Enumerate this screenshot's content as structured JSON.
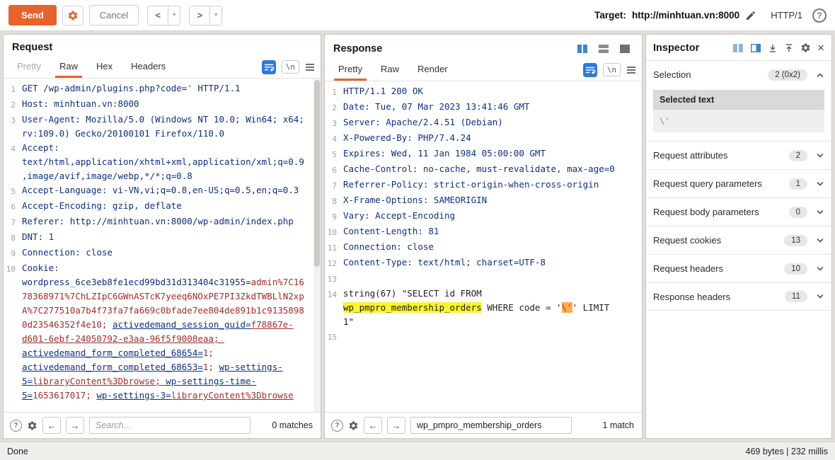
{
  "icons": {
    "dropdown": "▼",
    "help": "?",
    "close": "×",
    "back_arrow": "←",
    "forward_arrow": "→",
    "prev": "<",
    "next": ">"
  },
  "topbar": {
    "send_label": "Send",
    "cancel_label": "Cancel",
    "target_label": "Target:",
    "target_value": "http://minhtuan.vn:8000",
    "http_version": "HTTP/1"
  },
  "request": {
    "title": "Request",
    "tabs": [
      "Pretty",
      "Raw",
      "Hex",
      "Headers"
    ],
    "active_tab": "Raw",
    "muted_tab": "Pretty",
    "newline_glyph": "\\n",
    "search": {
      "placeholder": "Search...",
      "value": "",
      "matches": "0 matches"
    },
    "lines": [
      {
        "n": 1,
        "segs": [
          {
            "t": "GET /wp-admin/plugins.php",
            "c": "h"
          },
          {
            "t": "?code=",
            "c": "h"
          },
          {
            "t": "'",
            "c": "v"
          },
          {
            "t": " HTTP/1.1",
            "c": "h"
          }
        ]
      },
      {
        "n": 2,
        "segs": [
          {
            "t": "Host: minhtuan.vn:8000",
            "c": "h"
          }
        ]
      },
      {
        "n": 3,
        "segs": [
          {
            "t": "User-Agent: Mozilla/5.0 (Windows NT 10.0; Win64; x64; rv:109.0) Gecko/20100101 Firefox/110.0",
            "c": "h"
          }
        ]
      },
      {
        "n": 4,
        "segs": [
          {
            "t": "Accept: text/html,application/xhtml+xml,application/xml;q=0.9,image/avif,image/webp,*/*;q=0.8",
            "c": "h"
          }
        ]
      },
      {
        "n": 5,
        "segs": [
          {
            "t": "Accept-Language: vi-VN,vi;q=0.8,en-US;q=0.5,en;q=0.3",
            "c": "h"
          }
        ]
      },
      {
        "n": 6,
        "segs": [
          {
            "t": "Accept-Encoding: gzip, deflate",
            "c": "h"
          }
        ]
      },
      {
        "n": 7,
        "segs": [
          {
            "t": "Referer: http://minhtuan.vn:8000/wp-admin/index.php",
            "c": "h"
          }
        ]
      },
      {
        "n": 8,
        "segs": [
          {
            "t": "DNT: 1",
            "c": "h"
          }
        ]
      },
      {
        "n": 9,
        "segs": [
          {
            "t": "Connection: close",
            "c": "h"
          }
        ]
      },
      {
        "n": 10,
        "segs": [
          {
            "t": "Cookie: ",
            "c": "h"
          },
          {
            "t": "wordpress_6ce3eb8fe1ecd99bd31d313404c31955=",
            "c": "h"
          },
          {
            "t": "admin%7C1678368971%7ChLZIpC6GWnASTcK7yeeq6NOxPE7PI3ZkdTWBLlN2xpA%7C277510a7b4f73fa7fa669c0bfade7ee804de891b1c91358980d23546352f4e10; ",
            "c": "v"
          },
          {
            "t": "activedemand_session_guid=",
            "c": "u"
          },
          {
            "t": "f78867e-d601-6ebf-24050792-e3aa-96f5f9008eaa; ",
            "c": "vu"
          },
          {
            "t": "activedemand_form_completed_68654=",
            "c": "u"
          },
          {
            "t": "1; ",
            "c": "v"
          },
          {
            "t": "activedemand_form_completed_68653=",
            "c": "u"
          },
          {
            "t": "1; ",
            "c": "v"
          },
          {
            "t": "wp-settings-5=",
            "c": "u"
          },
          {
            "t": "libraryContent%3Dbrowse; ",
            "c": "vu"
          },
          {
            "t": "wp-settings-time-5=",
            "c": "u"
          },
          {
            "t": "1653617017; ",
            "c": "v"
          },
          {
            "t": "wp-settings-3=",
            "c": "u"
          },
          {
            "t": "libraryContent%3Dbrowse",
            "c": "vu"
          }
        ]
      }
    ]
  },
  "response": {
    "title": "Response",
    "tabs": [
      "Pretty",
      "Raw",
      "Render"
    ],
    "active_tab": "Pretty",
    "muted_tab": "",
    "newline_glyph": "\\n",
    "search": {
      "placeholder": "Search...",
      "value": "wp_pmpro_membership_orders",
      "matches": "1 match"
    },
    "lines": [
      {
        "n": 1,
        "segs": [
          {
            "t": "HTTP/1.1 200 OK",
            "c": "h"
          }
        ]
      },
      {
        "n": 2,
        "segs": [
          {
            "t": "Date: Tue, 07 Mar 2023 13:41:46 GMT",
            "c": "h"
          }
        ]
      },
      {
        "n": 3,
        "segs": [
          {
            "t": "Server: Apache/2.4.51 (Debian)",
            "c": "h"
          }
        ]
      },
      {
        "n": 4,
        "segs": [
          {
            "t": "X-Powered-By: PHP/7.4.24",
            "c": "h"
          }
        ]
      },
      {
        "n": 5,
        "segs": [
          {
            "t": "Expires: Wed, 11 Jan 1984 05:00:00 GMT",
            "c": "h"
          }
        ]
      },
      {
        "n": 6,
        "segs": [
          {
            "t": "Cache-Control: no-cache, must-revalidate, max-age=0",
            "c": "h"
          }
        ]
      },
      {
        "n": 7,
        "segs": [
          {
            "t": "Referrer-Policy: strict-origin-when-cross-origin",
            "c": "h"
          }
        ]
      },
      {
        "n": 8,
        "segs": [
          {
            "t": "X-Frame-Options: SAMEORIGIN",
            "c": "h"
          }
        ]
      },
      {
        "n": 9,
        "segs": [
          {
            "t": "Vary: Accept-Encoding",
            "c": "h"
          }
        ]
      },
      {
        "n": 10,
        "segs": [
          {
            "t": "Content-Length: 81",
            "c": "h"
          }
        ]
      },
      {
        "n": 11,
        "segs": [
          {
            "t": "Connection: close",
            "c": "h"
          }
        ]
      },
      {
        "n": 12,
        "segs": [
          {
            "t": "Content-Type: text/html; charset=UTF-8",
            "c": "h"
          }
        ]
      },
      {
        "n": 13,
        "segs": []
      },
      {
        "n": 14,
        "segs": [
          {
            "t": "string(67) \"SELECT id FROM ",
            "c": "p"
          },
          {
            "t": "wp_pmpro_membership_orders",
            "c": "hy"
          },
          {
            "t": " WHERE code = '",
            "c": "p"
          },
          {
            "t": "\\'",
            "c": "ho"
          },
          {
            "t": "' LIMIT 1\"",
            "c": "p"
          }
        ]
      },
      {
        "n": 15,
        "segs": []
      }
    ]
  },
  "inspector": {
    "title": "Inspector",
    "selection": {
      "label": "Selection",
      "badge": "2 (0x2)",
      "selected_text_label": "Selected text",
      "selected_text_value": "\\'"
    },
    "sections": [
      {
        "label": "Request attributes",
        "count": "2"
      },
      {
        "label": "Request query parameters",
        "count": "1"
      },
      {
        "label": "Request body parameters",
        "count": "0"
      },
      {
        "label": "Request cookies",
        "count": "13"
      },
      {
        "label": "Request headers",
        "count": "10"
      },
      {
        "label": "Response headers",
        "count": "11"
      }
    ]
  },
  "statusbar": {
    "left": "Done",
    "right": "469 bytes | 232 millis"
  }
}
